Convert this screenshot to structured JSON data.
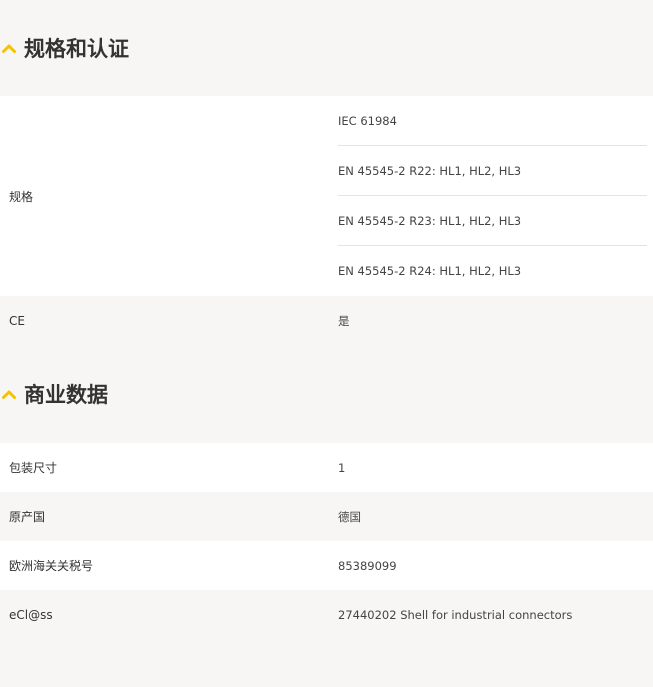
{
  "specs_section": {
    "title": "规格和认证",
    "standards_label": "规格",
    "standards": [
      "IEC 61984",
      "EN 45545-2 R22: HL1, HL2, HL3",
      "EN 45545-2 R23: HL1, HL2, HL3",
      "EN 45545-2 R24: HL1, HL2, HL3"
    ],
    "ce_label": "CE",
    "ce_value": "是"
  },
  "commercial_section": {
    "title": "商业数据",
    "rows": [
      {
        "label": "包装尺寸",
        "value": "1"
      },
      {
        "label": "原产国",
        "value": "德国"
      },
      {
        "label": "欧洲海关关税号",
        "value": "85389099"
      },
      {
        "label": "eCl@ss",
        "value": "27440202 Shell for industrial connectors"
      }
    ]
  },
  "accent_color": "#f5c400"
}
